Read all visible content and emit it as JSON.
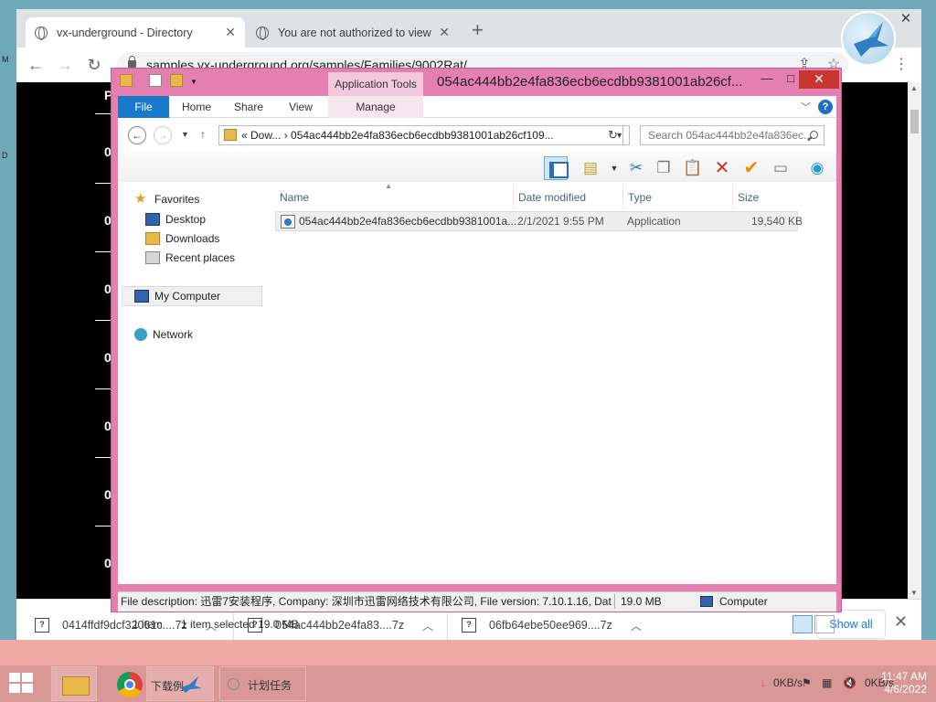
{
  "chrome": {
    "tabs": [
      {
        "label": "vx-underground - Directory"
      },
      {
        "label": "You are not authorized to view th"
      }
    ],
    "tab_close": "✕",
    "new_tab": "+",
    "window_close": "✕",
    "url": "samples.vx-underground.org/samples/Families/9002Rat/",
    "page_char": "P",
    "page_zero": "0",
    "downloads": [
      {
        "name": "0414ffdf9dcf32061c....7z"
      },
      {
        "name": "054ac444bb2e4fa83....7z"
      },
      {
        "name": "06fb64ebe50ee969....7z"
      }
    ],
    "show_all": "Show all"
  },
  "explorer": {
    "app_tools": "Application Tools",
    "title": "054ac444bb2e4fa836ecb6ecdbb9381001ab26cf...",
    "ribbon_tabs": [
      "File",
      "Home",
      "Share",
      "View",
      "Manage"
    ],
    "address_prefix": "«  Dow...  ›",
    "address_path": "054ac444bb2e4fa836ecb6ecdbb9381001ab26cf109...",
    "search_placeholder": "Search 054ac444bb2e4fa836ec...",
    "nav": {
      "favorites": "Favorites",
      "desktop": "Desktop",
      "downloads": "Downloads",
      "recent": "Recent places",
      "computer": "My Computer",
      "network": "Network"
    },
    "columns": {
      "name": "Name",
      "date": "Date modified",
      "type": "Type",
      "size": "Size"
    },
    "files": [
      {
        "name": "054ac444bb2e4fa836ecb6ecdbb9381001a...",
        "date": "2/1/2021 9:55 PM",
        "type": "Application",
        "size": "19,540 KB"
      }
    ],
    "status": {
      "count": "1 item",
      "selected": "1 item selected  19.0 MB"
    },
    "details": {
      "description": "File description: 迅雷7安装程序, Company: 深圳市迅雷网络技术有限公司, File version: 7.10.1.16, Dat",
      "size": "19.0 MB",
      "location": "Computer"
    }
  },
  "taskbar": {
    "thunder_label": "下载例",
    "task_label": "计划任务",
    "speed_down": "0KB/s",
    "speed_up": "0KB/s",
    "time": "11:47 AM",
    "date": "4/6/2022"
  }
}
